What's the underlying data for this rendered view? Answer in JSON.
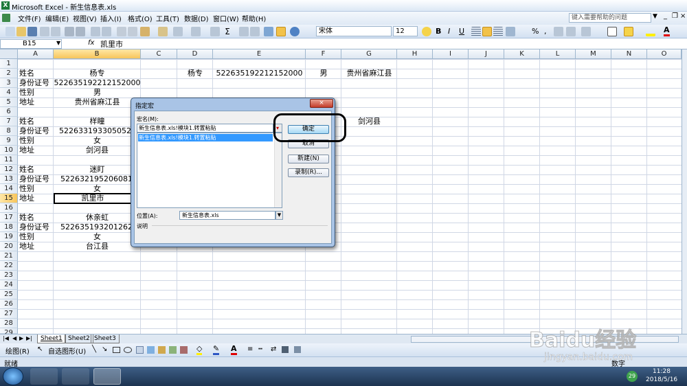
{
  "window": {
    "title": "Microsoft Excel - 新生信息表.xls",
    "help_placeholder": "键入需要帮助的问题"
  },
  "menu": [
    "文件(F)",
    "编辑(E)",
    "视图(V)",
    "插入(I)",
    "格式(O)",
    "工具(T)",
    "数据(D)",
    "窗口(W)",
    "帮助(H)"
  ],
  "toolbar": {
    "font_name": "宋体",
    "font_size": "12",
    "bold": "B",
    "italic": "I",
    "underline": "U",
    "percent": "%",
    "comma": ","
  },
  "formula_bar": {
    "name_box": "B15",
    "fx": "fx",
    "content": "凯里市"
  },
  "columns": [
    "A",
    "B",
    "C",
    "D",
    "E",
    "F",
    "G",
    "H",
    "I",
    "J",
    "K",
    "L",
    "M",
    "N",
    "O"
  ],
  "rows": [
    "1",
    "2",
    "3",
    "4",
    "5",
    "6",
    "7",
    "8",
    "9",
    "10",
    "11",
    "12",
    "13",
    "14",
    "15",
    "16",
    "17",
    "18",
    "19",
    "20",
    "21",
    "22",
    "23",
    "24",
    "25",
    "26",
    "27",
    "28",
    "29"
  ],
  "cells": {
    "a2": "姓名",
    "b2": "杨专",
    "d2": "杨专",
    "e2": "522635192212152000",
    "f2": "男",
    "g2": "贵州省麻江县",
    "a3": "身份证号",
    "b3": "522635192212152000",
    "a4": "性别",
    "b4": "男",
    "a5": "地址",
    "b5": "贵州省麻江县",
    "a7": "姓名",
    "b7": "样瞳",
    "g7": "剑河县",
    "a8": "身份证号",
    "b8": "522633193305052000",
    "a9": "性别",
    "b9": "女",
    "a10": "地址",
    "b10": "剑河县",
    "a12": "姓名",
    "b12": "迷盯",
    "a13": "身份证号",
    "b13": "522632195206081000",
    "a14": "性别",
    "b14": "女",
    "a15": "地址",
    "b15": "凯里市",
    "a17": "姓名",
    "b17": "休亲虹",
    "a18": "身份证号",
    "b18": "522635193201262000",
    "a19": "性别",
    "b19": "女",
    "a20": "地址",
    "b20": "台江县"
  },
  "sheets": [
    "Sheet1",
    "Sheet2",
    "Sheet3"
  ],
  "drawbar": {
    "draw": "绘图(R)",
    "autoshapes": "自选图形(U)"
  },
  "status": {
    "ready": "就绪",
    "mode": "数字"
  },
  "dialog": {
    "title": "指定宏",
    "macro_name_label": "宏名(M):",
    "macro_name_value": "新生信息表.xls!模块1.转置粘贴",
    "list_items": [
      "新生信息表.xls!模块1.转置粘贴"
    ],
    "ok": "确定",
    "cancel": "取消",
    "new": "新建(N)",
    "record": "录制(R)...",
    "location_label": "位置(A):",
    "location_value": "新生信息表.xls",
    "description_label": "说明"
  },
  "taskbar": {
    "time": "11:28",
    "date": "2018/5/16",
    "badge": "29"
  },
  "watermark": {
    "text": "Baidu经验",
    "url": "jingyan.baidu.com"
  }
}
